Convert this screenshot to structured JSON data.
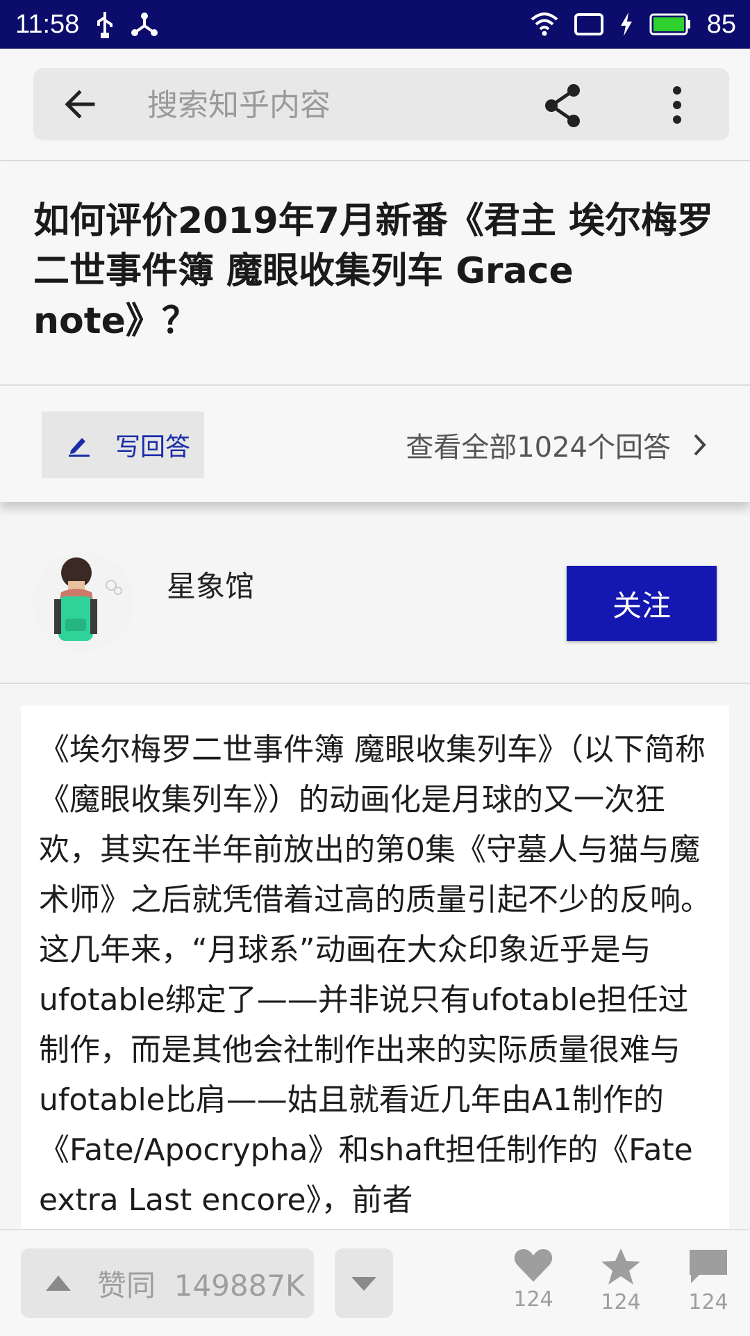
{
  "status_bar": {
    "time": "11:58",
    "battery": "85",
    "icons": [
      "usb-icon",
      "fork-icon",
      "wifi-icon",
      "screen-icon",
      "charging-icon",
      "battery-icon"
    ]
  },
  "search": {
    "placeholder": "搜索知乎内容"
  },
  "question": {
    "title": " 如何评价2019年7月新番《君主 埃尔梅罗二世事件簿 魔眼收集列车 Grace note》？",
    "write_answer": "写回答",
    "view_all": "查看全部1024个回答"
  },
  "author": {
    "name": "星象馆",
    "follow_label": "关注"
  },
  "answer": {
    "text": "《埃尔梅罗二世事件簿 魔眼收集列车》（以下简称《魔眼收集列车》）的动画化是月球的又一次狂欢，其实在半年前放出的第0集《守墓人与猫与魔术师》之后就凭借着过高的质量引起不少的反响。这几年来，“月球系”动画在大众印象近乎是与ufotable绑定了——并非说只有ufotable担任过制作，而是其他会社制作出来的实际质量很难与ufotable比肩——姑且就看近几年由A1制作的《Fate/Apocrypha》和shaft担任制作的《Fate extra Last encore》，前者"
  },
  "bottom_bar": {
    "vote_up_label": "赞同",
    "vote_count": "149887K",
    "likes": "124",
    "favorites": "124",
    "comments": "124"
  },
  "colors": {
    "status_bar": "#0b0c6b",
    "accent": "#1518b0",
    "write_answer_text": "#1a2ca8"
  }
}
